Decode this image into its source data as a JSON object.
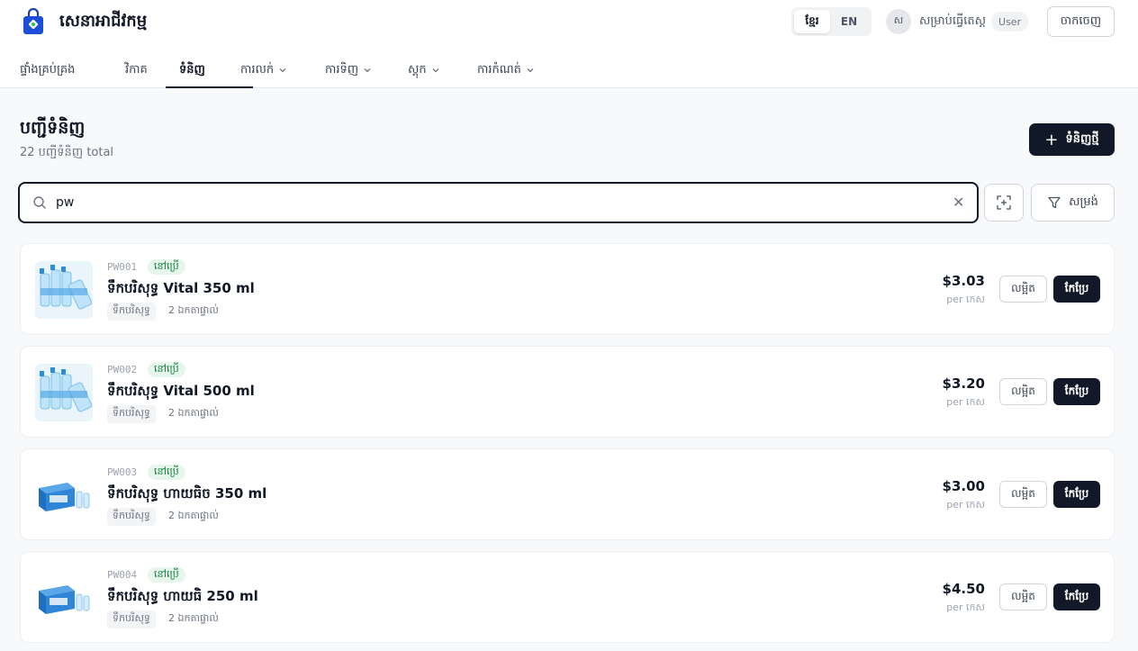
{
  "app": {
    "name": "សេនាអាជីវកម្ម",
    "logo_icon": "shopping-bag-icon"
  },
  "lang": {
    "active": "ខ្មែរ",
    "other": "EN"
  },
  "user": {
    "initial": "ស",
    "name": "សម្រាប់ធ្វើតេស្ត",
    "role": "User"
  },
  "logout_label": "ចាកចេញ",
  "nav": {
    "dashboard": "ផ្ទាំងគ្រប់គ្រង",
    "invoice": "វិកាគ",
    "products": "ទំនិញ",
    "sales": "ការលក់",
    "purchases": "ការទិញ",
    "stock": "ស្តុក",
    "settings": "ការកំណត់"
  },
  "page": {
    "title": "បញ្ជីទំនិញ",
    "subtitle": "22 បញ្ជីទំនិញ total",
    "new_label": "ទំនិញថ្មី"
  },
  "search": {
    "value": "pw",
    "filter_label": "សម្រង់"
  },
  "colors": {
    "primary": "#111827",
    "status_bg": "#e7f6ec",
    "status_fg": "#15803d"
  },
  "products": [
    {
      "sku": "PW001",
      "status": "នៅប្រើ",
      "name": "ទឹកបរិសុទ្ធ Vital 350 ml",
      "category": "ទឹកបរិសុទ្ធ",
      "units": "2 ឯកតាផ្ទាល់",
      "price": "$3.03",
      "per": "per កេស",
      "view": "លម្អិត",
      "edit": "កែប្រែ"
    },
    {
      "sku": "PW002",
      "status": "នៅប្រើ",
      "name": "ទឹកបរិសុទ្ធ Vital 500 ml",
      "category": "ទឹកបរិសុទ្ធ",
      "units": "2 ឯកតាផ្ទាល់",
      "price": "$3.20",
      "per": "per កេស",
      "view": "លម្អិត",
      "edit": "កែប្រែ"
    },
    {
      "sku": "PW003",
      "status": "នៅប្រើ",
      "name": "ទឹកបរិសុទ្ធ ហាយធិច 350 ml",
      "category": "ទឹកបរិសុទ្ធ",
      "units": "2 ឯកតាផ្ទាល់",
      "price": "$3.00",
      "per": "per កេស",
      "view": "លម្អិត",
      "edit": "កែប្រែ"
    },
    {
      "sku": "PW004",
      "status": "នៅប្រើ",
      "name": "ទឹកបរិសុទ្ធ ហាយធិ 250 ml",
      "category": "ទឹកបរិសុទ្ធ",
      "units": "2 ឯកតាផ្ទាល់",
      "price": "$4.50",
      "per": "per កេស",
      "view": "លម្អិត",
      "edit": "កែប្រែ"
    }
  ]
}
